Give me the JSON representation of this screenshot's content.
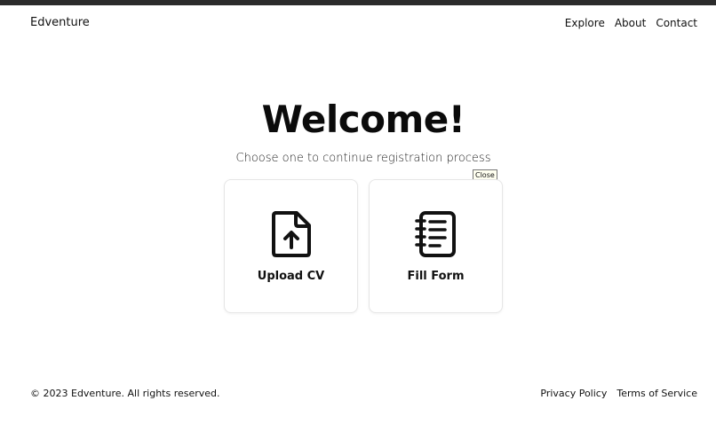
{
  "header": {
    "brand": "Edventure",
    "nav": [
      "Explore",
      "About",
      "Contact"
    ]
  },
  "hero": {
    "title": "Welcome!",
    "subtitle": "Choose one to continue registration process"
  },
  "tooltip": "Close",
  "cards": [
    {
      "label": "Upload CV",
      "icon": "file-upload-icon"
    },
    {
      "label": "Fill Form",
      "icon": "notebook-icon"
    }
  ],
  "footer": {
    "copyright": "© 2023 Edventure. All rights reserved.",
    "links": [
      "Privacy Policy",
      "Terms of Service"
    ]
  }
}
